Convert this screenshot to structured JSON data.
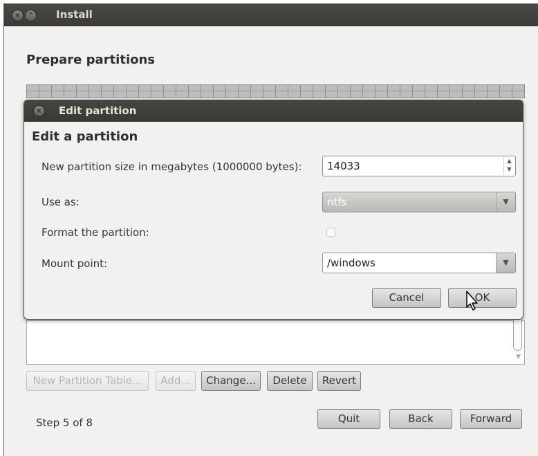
{
  "window": {
    "title": "Install",
    "heading": "Prepare partitions",
    "buttons": {
      "close": "×",
      "minimize": "^"
    }
  },
  "partition_table_buttons": {
    "new_table": "New Partition Table...",
    "add": "Add...",
    "change": "Change...",
    "delete": "Delete",
    "revert": "Revert"
  },
  "footer": {
    "step": "Step 5 of 8",
    "quit": "Quit",
    "back": "Back",
    "forward": "Forward"
  },
  "dialog": {
    "title": "Edit partition",
    "heading": "Edit a partition",
    "size_label": "New partition size in megabytes (1000000 bytes):",
    "size_value": "14033",
    "use_as_label": "Use as:",
    "use_as_value": "ntfs",
    "format_label": "Format the partition:",
    "format_checked": false,
    "mount_label": "Mount point:",
    "mount_value": "/windows",
    "cancel": "Cancel",
    "ok": "OK",
    "close_glyph": "×"
  },
  "icons": {
    "spin_up": "▲",
    "spin_down": "▼",
    "dropdown": "▼"
  },
  "colors": {
    "titlebar": "#3c3b37",
    "window_bg": "#f2f1f0"
  }
}
